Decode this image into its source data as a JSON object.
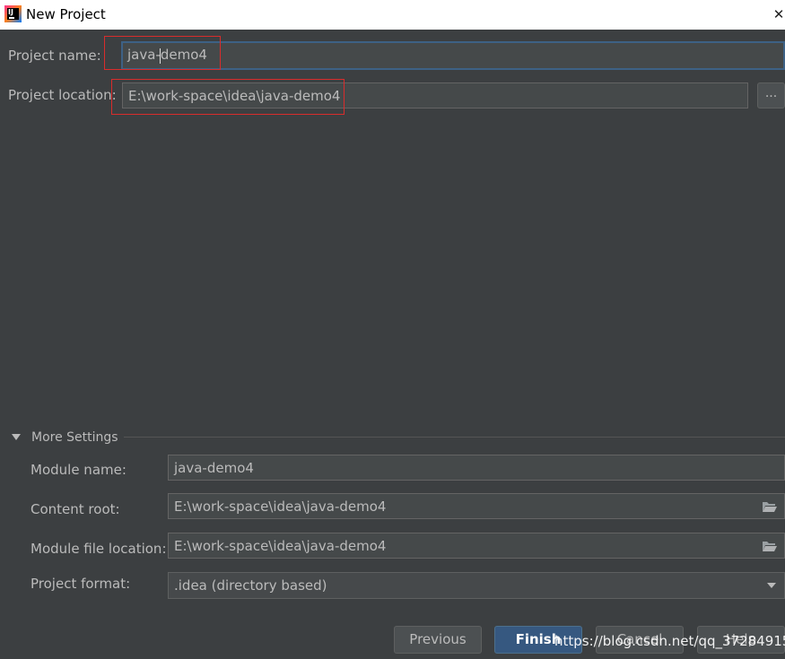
{
  "window": {
    "title": "New Project"
  },
  "project": {
    "name_label": "Project name:",
    "name_value": "java-demo4",
    "location_label": "Project location:",
    "location_value": "E:\\work-space\\idea\\java-demo4",
    "browse_label": "..."
  },
  "more_settings": {
    "title": "More Settings",
    "module_name_label": "Module name:",
    "module_name_value": "java-demo4",
    "content_root_label": "Content root:",
    "content_root_value": "E:\\work-space\\idea\\java-demo4",
    "module_file_label": "Module file location:",
    "module_file_value": "E:\\work-space\\idea\\java-demo4",
    "format_label": "Project format:",
    "format_value": ".idea (directory based)"
  },
  "buttons": {
    "previous": "Previous",
    "finish": "Finish",
    "cancel": "Cancel",
    "help": "Help"
  },
  "watermark": "https://blog.csdn.net/qq_37284915",
  "colors": {
    "background": "#3c3f41",
    "field_bg": "#45494a",
    "focus_border": "#3d6185",
    "highlight": "#d92c2c",
    "primary_button": "#365880"
  }
}
